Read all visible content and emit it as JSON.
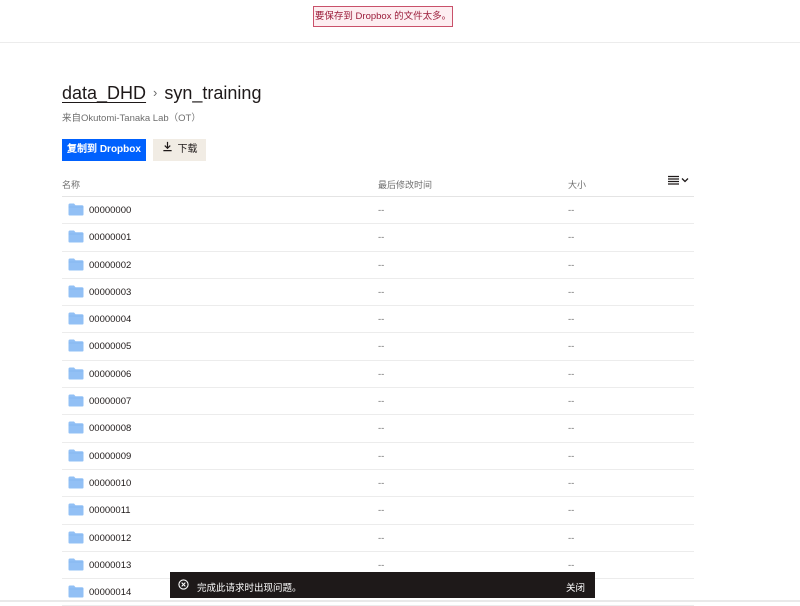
{
  "banner": {
    "text": "要保存到 Dropbox 的文件太多。"
  },
  "breadcrumb": {
    "parent": "data_DHD",
    "separator": "›",
    "current": "syn_training"
  },
  "subtitle": "来自Okutomi-Tanaka Lab（OT）",
  "actions": {
    "copy_label": "复制到 Dropbox",
    "download_label": "下载"
  },
  "table": {
    "headers": {
      "name": "名称",
      "modified": "最后修改时间",
      "size": "大小"
    },
    "rows": [
      {
        "name": "00000000",
        "modified": "--",
        "size": "--"
      },
      {
        "name": "00000001",
        "modified": "--",
        "size": "--"
      },
      {
        "name": "00000002",
        "modified": "--",
        "size": "--"
      },
      {
        "name": "00000003",
        "modified": "--",
        "size": "--"
      },
      {
        "name": "00000004",
        "modified": "--",
        "size": "--"
      },
      {
        "name": "00000005",
        "modified": "--",
        "size": "--"
      },
      {
        "name": "00000006",
        "modified": "--",
        "size": "--"
      },
      {
        "name": "00000007",
        "modified": "--",
        "size": "--"
      },
      {
        "name": "00000008",
        "modified": "--",
        "size": "--"
      },
      {
        "name": "00000009",
        "modified": "--",
        "size": "--"
      },
      {
        "name": "00000010",
        "modified": "--",
        "size": "--"
      },
      {
        "name": "00000011",
        "modified": "--",
        "size": "--"
      },
      {
        "name": "00000012",
        "modified": "--",
        "size": "--"
      },
      {
        "name": "00000013",
        "modified": "--",
        "size": "--"
      },
      {
        "name": "00000014",
        "modified": "",
        "size": ""
      }
    ]
  },
  "toast": {
    "message": "完成此请求时出现问题。",
    "close_label": "关闭"
  },
  "icons": {
    "folder": "folder-icon",
    "download": "download-icon",
    "list_view": "list-view-icon",
    "chevron": "chevron-down-icon",
    "error": "error-circle-icon"
  },
  "colors": {
    "primary": "#0061fe",
    "folder": "#92c0f5",
    "banner_border": "#c9516a",
    "toast_bg": "#1e1919"
  }
}
